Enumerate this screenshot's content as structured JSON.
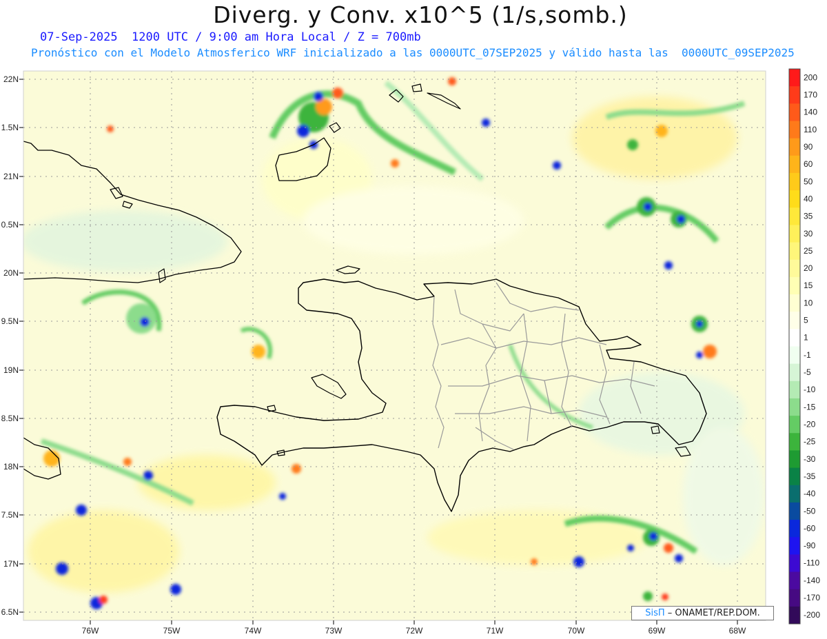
{
  "title": "Diverg. y Conv. x10^5 (1/s,somb.)",
  "subtitle_line1": "07-Sep-2025  1200 UTC / 9:00 am Hora Local / Z = 700mb",
  "subtitle_line2": "Pronóstico con el Modelo Atmosferico WRF inicializado a las 0000UTC_07SEP2025 y válido hasta las  0000UTC_09SEP2025",
  "credit": {
    "brand": "SisΠ",
    "rest": " – ONAMET/REP.DOM."
  },
  "latitude_labels": [
    "22N",
    "1.5N",
    "21N",
    "0.5N",
    "20N",
    "9.5N",
    "19N",
    "8.5N",
    "18N",
    "7.5N",
    "17N",
    "6.5N"
  ],
  "longitude_labels": [
    "76W",
    "75W",
    "74W",
    "73W",
    "72W",
    "71W",
    "70W",
    "69W",
    "68W"
  ],
  "colorbar": {
    "labels": [
      "200",
      "170",
      "140",
      "110",
      "90",
      "60",
      "50",
      "40",
      "35",
      "30",
      "25",
      "20",
      "15",
      "10",
      "5",
      "1",
      "-1",
      "-5",
      "-10",
      "-15",
      "-20",
      "-25",
      "-30",
      "-35",
      "-40",
      "-50",
      "-60",
      "-90",
      "-110",
      "-140",
      "-170",
      "-200"
    ],
    "colors": [
      "#ff1a1a",
      "#ff3b1a",
      "#ff5a1a",
      "#ff7a1a",
      "#ff9a1a",
      "#ffb41a",
      "#ffca1a",
      "#ffdc1a",
      "#ffe83a",
      "#fff05a",
      "#fff67a",
      "#fffa9a",
      "#ffffb4",
      "#ffffd2",
      "#ffffe8",
      "#ffffff",
      "#f0fff0",
      "#d6f5d6",
      "#b4ebb4",
      "#8cdc8c",
      "#64cc64",
      "#3cb43c",
      "#1e9b32",
      "#0a8246",
      "#0a6e6e",
      "#0a4ba0",
      "#0a28dc",
      "#1e14f0",
      "#3c0ad2",
      "#4b0aa0",
      "#460a82",
      "#320a5a"
    ]
  },
  "colors": {
    "title": "#111111",
    "subtitle1": "#1a1aff",
    "subtitle2": "#1a8cff",
    "coast": "#000000",
    "provinces": "#9a9a9a"
  }
}
